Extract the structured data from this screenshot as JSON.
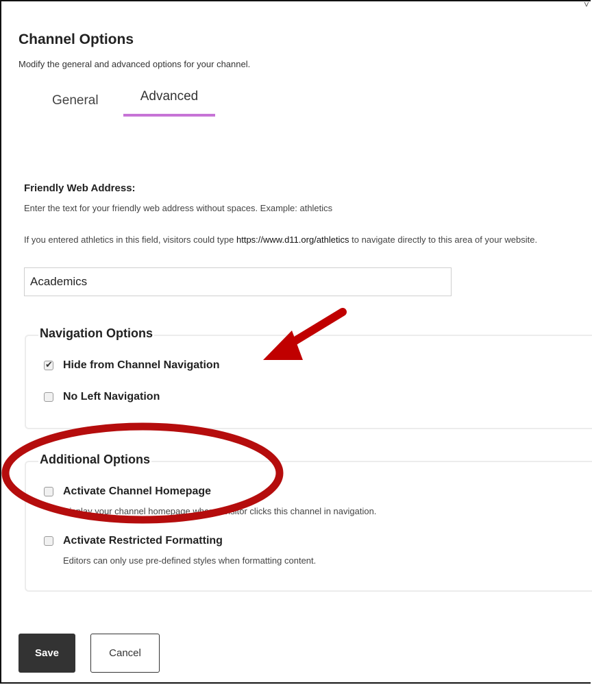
{
  "dialog": {
    "title": "Channel Options",
    "subtitle": "Modify the general and advanced options for your channel.",
    "corner_mark": "˅"
  },
  "tabs": [
    {
      "label": "General",
      "active": false
    },
    {
      "label": "Advanced",
      "active": true
    }
  ],
  "friendly_address": {
    "label": "Friendly Web Address:",
    "help": "Enter the text for your friendly web address without spaces. Example: athletics",
    "help2_prefix": "If you entered athletics in this field, visitors could type ",
    "help2_url": "https://www.d11.org/athletics",
    "help2_suffix": " to navigate directly to this area of your website.",
    "value": "Academics"
  },
  "navigation_options": {
    "legend": "Navigation Options",
    "items": [
      {
        "label": "Hide from Channel Navigation",
        "checked": true
      },
      {
        "label": "No Left Navigation",
        "checked": false
      }
    ]
  },
  "additional_options": {
    "legend": "Additional Options",
    "items": [
      {
        "label": "Activate Channel Homepage",
        "description": "Display your channel homepage when a visitor clicks this channel in navigation.",
        "checked": false
      },
      {
        "label": "Activate Restricted Formatting",
        "description": "Editors can only use pre-defined styles when formatting content.",
        "checked": false
      }
    ]
  },
  "actions": {
    "save": "Save",
    "cancel": "Cancel"
  },
  "annotations": {
    "arrow_color": "#c00000",
    "ellipse_color": "#b50d0d"
  },
  "colors": {
    "tab_accent": "#c774d6",
    "save_bg": "#333333"
  },
  "check_glyph": "✔"
}
